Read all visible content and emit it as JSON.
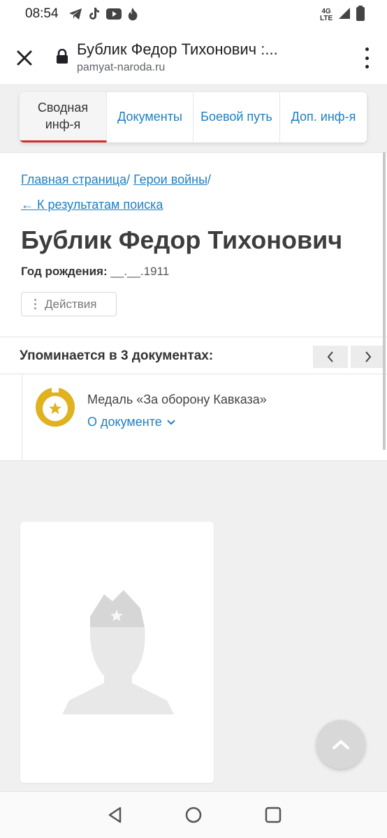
{
  "status_bar": {
    "time": "08:54",
    "icons": [
      "telegram-icon",
      "tiktok-icon",
      "youtube-icon",
      "tinder-icon"
    ],
    "network": "4G LTE",
    "right_icons": [
      "signal-icon",
      "battery-icon"
    ]
  },
  "browser": {
    "title": "Бублик Федор Тихонович :...",
    "url": "pamyat-naroda.ru"
  },
  "tabs": [
    {
      "label": "Сводная\nинф-я",
      "active": true
    },
    {
      "label": "Документы",
      "active": false
    },
    {
      "label": "Боевой путь",
      "active": false
    },
    {
      "label": "Доп. инф-я",
      "active": false
    }
  ],
  "breadcrumb": {
    "home": "Главная страница",
    "heroes": "Герои войны",
    "back": "← К результатам поиска"
  },
  "hero": {
    "name": "Бублик Федор Тихонович",
    "birth_label": "Год рождения:",
    "birth_value": "__.__.1911",
    "actions_label": "Действия"
  },
  "mentions": {
    "title": "Упоминается в 3 документах:",
    "documents": [
      {
        "title": "Медаль «За оборону Кавказа»",
        "link": "О документе"
      }
    ]
  },
  "colors": {
    "link": "#1f7fc4",
    "accent_red": "#d42d2d",
    "medal_gold": "#e0b21f"
  }
}
